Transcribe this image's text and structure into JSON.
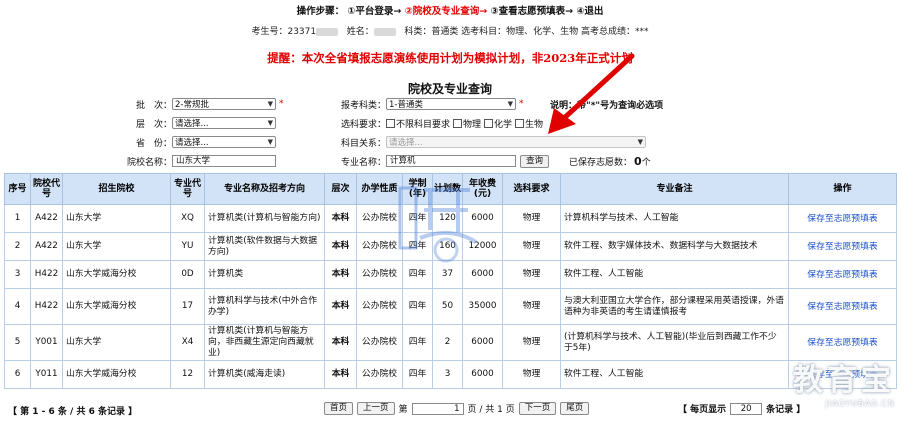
{
  "steps": {
    "label": "操作步骤：",
    "s1": "①平台登录→",
    "s2": "②院校及专业查询→",
    "s3": "③查看志愿预填表→",
    "s4": "④退出"
  },
  "info": {
    "exam_no_label": "考生号：",
    "exam_no": "23371",
    "name_label": "姓名：",
    "rest": "科类：普通类  选考科目：物理、化学、生物  高考总成绩：***"
  },
  "tip": "提醒：本次全省填报志愿演练使用计划为模拟计划，非2023年正式计划",
  "page_title": "院校及专业查询",
  "form": {
    "batch_label": "批　次：",
    "batch_value": "2-常规批",
    "level_label": "层　次：",
    "level_value": "请选择...",
    "province_label": "省　份：",
    "province_value": "请选择...",
    "school_label": "院校名称：",
    "school_value": "山东大学",
    "category_label": "报考科类：",
    "category_value": "1-普通类",
    "subject_req_label": "选科要求：",
    "opt_none": "不限科目要求",
    "opt_physics": "物理",
    "opt_chem": "化学",
    "opt_bio": "生物",
    "subject_rel_label": "科目关系：",
    "subject_rel_value": "请选择...",
    "major_label": "专业名称：",
    "major_value": "计算机",
    "query_btn": "查询",
    "saved_label": "已保存志愿数：",
    "saved_count": "0",
    "saved_unit": "个",
    "note": "说明：带\"*\"号为查询必选项",
    "required_mark": "*"
  },
  "table": {
    "headers": [
      "序号",
      "院校代号",
      "招生院校",
      "专业代号",
      "专业名称及招考方向",
      "层次",
      "办学性质",
      "学制(年)",
      "计划数",
      "年收费(元)",
      "选科要求",
      "专业备注",
      "操作"
    ],
    "rows": [
      [
        "1",
        "A422",
        "山东大学",
        "XQ",
        "计算机类(计算机与智能方向)",
        "本科",
        "公办院校",
        "四年",
        "120",
        "6000",
        "物理",
        "计算机科学与技术、人工智能",
        "保存至志愿预填表"
      ],
      [
        "2",
        "A422",
        "山东大学",
        "YU",
        "计算机类(软件数据与大数据方向)",
        "本科",
        "公办院校",
        "四年",
        "160",
        "12000",
        "物理",
        "软件工程、数字媒体技术、数据科学与大数据技术",
        "保存至志愿预填表"
      ],
      [
        "3",
        "H422",
        "山东大学威海分校",
        "0D",
        "计算机类",
        "本科",
        "公办院校",
        "四年",
        "37",
        "6000",
        "物理",
        "软件工程、人工智能",
        "保存至志愿预填表"
      ],
      [
        "4",
        "H422",
        "山东大学威海分校",
        "17",
        "计算机科学与技术(中外合作办学)",
        "本科",
        "公办院校",
        "四年",
        "50",
        "35000",
        "物理",
        "与澳大利亚国立大学合作，部分课程采用英语授课，外语语种为非英语的考生请谨慎报考",
        "保存至志愿预填表"
      ],
      [
        "5",
        "Y001",
        "山东大学",
        "X4",
        "计算机类(计算机与智能方向，非西藏生源定向西藏就业)",
        "本科",
        "公办院校",
        "四年",
        "2",
        "6000",
        "物理",
        "(计算机科学与技术、人工智能)(毕业后到西藏工作不少于5年)",
        "保存至志愿预填表"
      ],
      [
        "6",
        "Y011",
        "山东大学威海分校",
        "12",
        "计算机类(威海走读)",
        "本科",
        "公办院校",
        "四年",
        "3",
        "6000",
        "物理",
        "软件工程、人工智能",
        "保存至志愿预填表"
      ]
    ]
  },
  "footer": {
    "summary": "【 第 1 - 6 条 / 共 6 条记录 】",
    "first": "首页",
    "prev": "上一页",
    "page_prefix": "第",
    "page_value": "1",
    "page_suffix": "页 / 共 1 页",
    "next": "下一页",
    "last": "尾页",
    "per_page_prefix": "【 每页显示",
    "per_page_value": "20",
    "per_page_suffix": "条记录 】"
  },
  "watermark": {
    "text": "教育宝",
    "url": "JIAOYUBAO.CN"
  },
  "colors": {
    "red": "#e00000",
    "header_blue": "#d3e3f7",
    "link": "#1d4fcf"
  }
}
